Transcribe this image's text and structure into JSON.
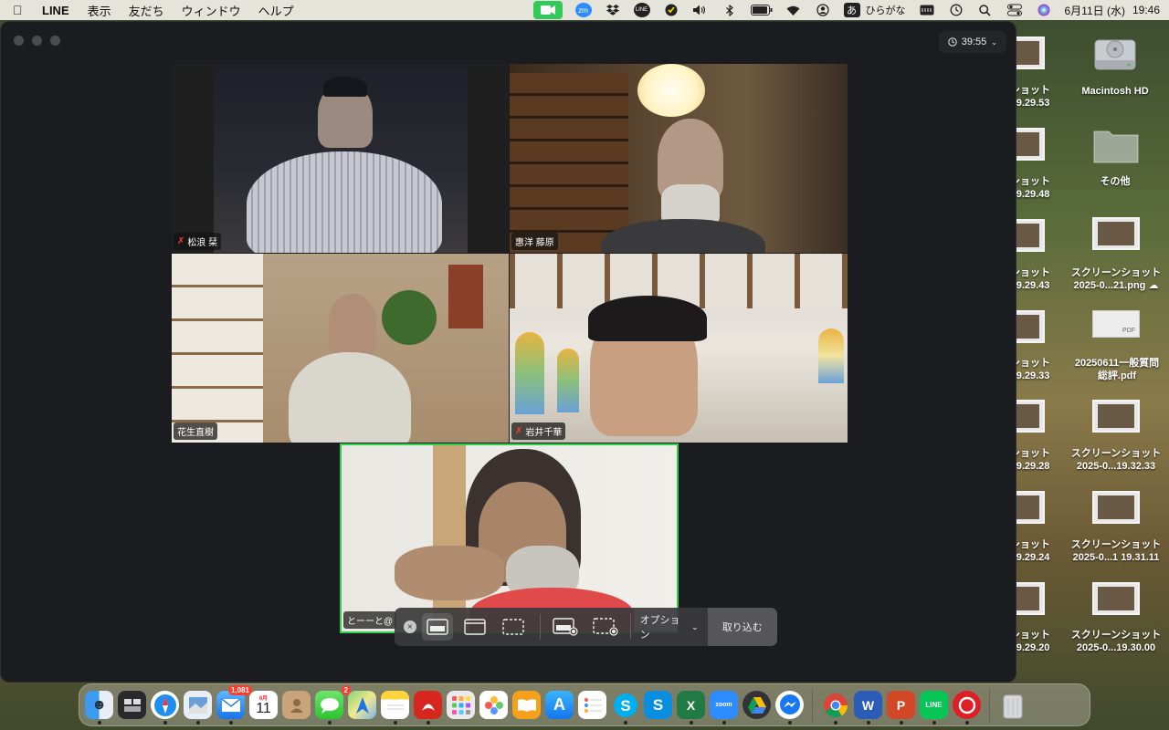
{
  "menubar": {
    "app_name": "LINE",
    "menus": [
      "表示",
      "友だち",
      "ウィンドウ",
      "ヘルプ"
    ],
    "zoom_label": "zm",
    "line_label": "LINE",
    "ime_char": "あ",
    "ime_label": "ひらがな",
    "date": "6月11日 (水)",
    "time": "19:46"
  },
  "zoom": {
    "timer": "39:55",
    "participants": [
      {
        "name": "松浪 栞",
        "muted": true
      },
      {
        "name": "惠洋 藤原",
        "muted": false
      },
      {
        "name": "花生直樹",
        "muted": false
      },
      {
        "name": "岩井千華",
        "muted": true
      },
      {
        "name": "とーーと@",
        "muted": false
      }
    ]
  },
  "screenshot_toolbar": {
    "options_label": "オプション",
    "capture_label": "取り込む"
  },
  "desktop": {
    "left_column": [
      {
        "line1": "ショット",
        "line2": "19.29.53"
      },
      {
        "line1": "ショット",
        "line2": "19.29.48"
      },
      {
        "line1": "ショット",
        "line2": "19.29.43"
      },
      {
        "line1": "ショット",
        "line2": "19.29.33"
      },
      {
        "line1": "ショット",
        "line2": "19.29.28"
      },
      {
        "line1": "ショット",
        "line2": "19.29.24"
      },
      {
        "line1": "ショット",
        "line2": "19.29.20"
      }
    ],
    "right_column": [
      {
        "line1": "Macintosh HD",
        "line2": ""
      },
      {
        "line1": "その他",
        "line2": ""
      },
      {
        "line1": "スクリーンショット",
        "line2": "2025-0...21.png"
      },
      {
        "line1": "20250611一般質問",
        "line2": "総評.pdf"
      },
      {
        "line1": "スクリーンショット",
        "line2": "2025-0...19.32.33"
      },
      {
        "line1": "スクリーンショット",
        "line2": "2025-0...1 19.31.11"
      },
      {
        "line1": "スクリーンショット",
        "line2": "2025-0...19.30.00"
      }
    ],
    "pdf_badge": "PDF"
  },
  "dock": {
    "mail_badge": "1,081",
    "calendar_month": "6月",
    "calendar_day": "11",
    "messages_badge": "2",
    "zoom_label": "zoom",
    "line_label": "LINE"
  }
}
